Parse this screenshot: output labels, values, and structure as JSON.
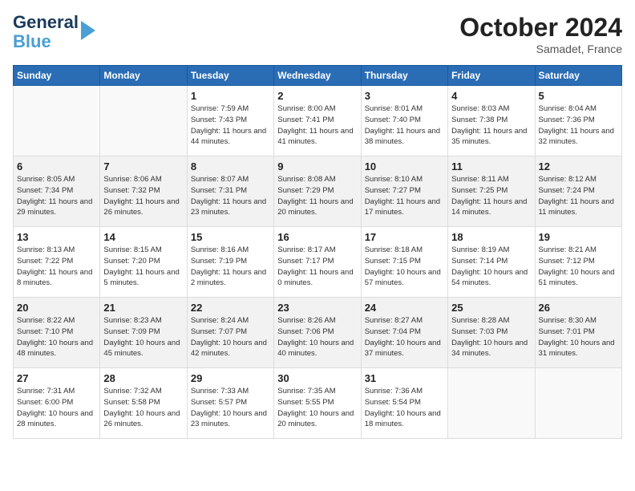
{
  "logo": {
    "line1": "General",
    "line2": "Blue"
  },
  "title": "October 2024",
  "location": "Samadet, France",
  "days_of_week": [
    "Sunday",
    "Monday",
    "Tuesday",
    "Wednesday",
    "Thursday",
    "Friday",
    "Saturday"
  ],
  "weeks": [
    [
      {
        "num": "",
        "info": ""
      },
      {
        "num": "",
        "info": ""
      },
      {
        "num": "1",
        "info": "Sunrise: 7:59 AM\nSunset: 7:43 PM\nDaylight: 11 hours and 44 minutes."
      },
      {
        "num": "2",
        "info": "Sunrise: 8:00 AM\nSunset: 7:41 PM\nDaylight: 11 hours and 41 minutes."
      },
      {
        "num": "3",
        "info": "Sunrise: 8:01 AM\nSunset: 7:40 PM\nDaylight: 11 hours and 38 minutes."
      },
      {
        "num": "4",
        "info": "Sunrise: 8:03 AM\nSunset: 7:38 PM\nDaylight: 11 hours and 35 minutes."
      },
      {
        "num": "5",
        "info": "Sunrise: 8:04 AM\nSunset: 7:36 PM\nDaylight: 11 hours and 32 minutes."
      }
    ],
    [
      {
        "num": "6",
        "info": "Sunrise: 8:05 AM\nSunset: 7:34 PM\nDaylight: 11 hours and 29 minutes."
      },
      {
        "num": "7",
        "info": "Sunrise: 8:06 AM\nSunset: 7:32 PM\nDaylight: 11 hours and 26 minutes."
      },
      {
        "num": "8",
        "info": "Sunrise: 8:07 AM\nSunset: 7:31 PM\nDaylight: 11 hours and 23 minutes."
      },
      {
        "num": "9",
        "info": "Sunrise: 8:08 AM\nSunset: 7:29 PM\nDaylight: 11 hours and 20 minutes."
      },
      {
        "num": "10",
        "info": "Sunrise: 8:10 AM\nSunset: 7:27 PM\nDaylight: 11 hours and 17 minutes."
      },
      {
        "num": "11",
        "info": "Sunrise: 8:11 AM\nSunset: 7:25 PM\nDaylight: 11 hours and 14 minutes."
      },
      {
        "num": "12",
        "info": "Sunrise: 8:12 AM\nSunset: 7:24 PM\nDaylight: 11 hours and 11 minutes."
      }
    ],
    [
      {
        "num": "13",
        "info": "Sunrise: 8:13 AM\nSunset: 7:22 PM\nDaylight: 11 hours and 8 minutes."
      },
      {
        "num": "14",
        "info": "Sunrise: 8:15 AM\nSunset: 7:20 PM\nDaylight: 11 hours and 5 minutes."
      },
      {
        "num": "15",
        "info": "Sunrise: 8:16 AM\nSunset: 7:19 PM\nDaylight: 11 hours and 2 minutes."
      },
      {
        "num": "16",
        "info": "Sunrise: 8:17 AM\nSunset: 7:17 PM\nDaylight: 11 hours and 0 minutes."
      },
      {
        "num": "17",
        "info": "Sunrise: 8:18 AM\nSunset: 7:15 PM\nDaylight: 10 hours and 57 minutes."
      },
      {
        "num": "18",
        "info": "Sunrise: 8:19 AM\nSunset: 7:14 PM\nDaylight: 10 hours and 54 minutes."
      },
      {
        "num": "19",
        "info": "Sunrise: 8:21 AM\nSunset: 7:12 PM\nDaylight: 10 hours and 51 minutes."
      }
    ],
    [
      {
        "num": "20",
        "info": "Sunrise: 8:22 AM\nSunset: 7:10 PM\nDaylight: 10 hours and 48 minutes."
      },
      {
        "num": "21",
        "info": "Sunrise: 8:23 AM\nSunset: 7:09 PM\nDaylight: 10 hours and 45 minutes."
      },
      {
        "num": "22",
        "info": "Sunrise: 8:24 AM\nSunset: 7:07 PM\nDaylight: 10 hours and 42 minutes."
      },
      {
        "num": "23",
        "info": "Sunrise: 8:26 AM\nSunset: 7:06 PM\nDaylight: 10 hours and 40 minutes."
      },
      {
        "num": "24",
        "info": "Sunrise: 8:27 AM\nSunset: 7:04 PM\nDaylight: 10 hours and 37 minutes."
      },
      {
        "num": "25",
        "info": "Sunrise: 8:28 AM\nSunset: 7:03 PM\nDaylight: 10 hours and 34 minutes."
      },
      {
        "num": "26",
        "info": "Sunrise: 8:30 AM\nSunset: 7:01 PM\nDaylight: 10 hours and 31 minutes."
      }
    ],
    [
      {
        "num": "27",
        "info": "Sunrise: 7:31 AM\nSunset: 6:00 PM\nDaylight: 10 hours and 28 minutes."
      },
      {
        "num": "28",
        "info": "Sunrise: 7:32 AM\nSunset: 5:58 PM\nDaylight: 10 hours and 26 minutes."
      },
      {
        "num": "29",
        "info": "Sunrise: 7:33 AM\nSunset: 5:57 PM\nDaylight: 10 hours and 23 minutes."
      },
      {
        "num": "30",
        "info": "Sunrise: 7:35 AM\nSunset: 5:55 PM\nDaylight: 10 hours and 20 minutes."
      },
      {
        "num": "31",
        "info": "Sunrise: 7:36 AM\nSunset: 5:54 PM\nDaylight: 10 hours and 18 minutes."
      },
      {
        "num": "",
        "info": ""
      },
      {
        "num": "",
        "info": ""
      }
    ]
  ]
}
